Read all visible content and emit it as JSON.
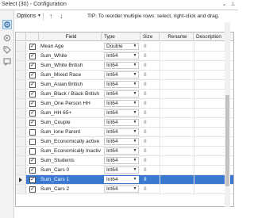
{
  "window": {
    "title": "Select (30) - Configuration"
  },
  "toolbar": {
    "options_label": "Options",
    "tip": "TIP: To reorder multiple rows: select, right-click and drag."
  },
  "grid": {
    "columns": [
      "Field",
      "Type",
      "Size",
      "Rename",
      "Description"
    ],
    "rows": [
      {
        "checked": true,
        "field": "Mean Age",
        "type": "Double",
        "size": "8",
        "selected": false
      },
      {
        "checked": true,
        "field": "Sum_White",
        "type": "Int64",
        "size": "8",
        "selected": false
      },
      {
        "checked": true,
        "field": "Sum_White British",
        "type": "Int64",
        "size": "8",
        "selected": false
      },
      {
        "checked": true,
        "field": "Sum_Mixed Race",
        "type": "Int64",
        "size": "8",
        "selected": false
      },
      {
        "checked": true,
        "field": "Sum_Asian British",
        "type": "Int64",
        "size": "8",
        "selected": false
      },
      {
        "checked": true,
        "field": "Sum_Black / Black British",
        "type": "Int64",
        "size": "8",
        "selected": false
      },
      {
        "checked": true,
        "field": "Sum_One Person HH",
        "type": "Int64",
        "size": "8",
        "selected": false
      },
      {
        "checked": true,
        "field": "Sum_HH 65+",
        "type": "Int64",
        "size": "8",
        "selected": false
      },
      {
        "checked": true,
        "field": "Sum_Couple",
        "type": "Int64",
        "size": "8",
        "selected": false
      },
      {
        "checked": false,
        "field": "Sum_lone Parent",
        "type": "Int64",
        "size": "8",
        "selected": false
      },
      {
        "checked": false,
        "field": "Sum_Economically active",
        "type": "Int64",
        "size": "8",
        "selected": false
      },
      {
        "checked": false,
        "field": "Sum_Economically Inactive",
        "type": "Int64",
        "size": "8",
        "selected": false
      },
      {
        "checked": true,
        "field": "Sum_Students",
        "type": "Int64",
        "size": "8",
        "selected": false
      },
      {
        "checked": true,
        "field": "Sum_Cars 0",
        "type": "Int64",
        "size": "8",
        "selected": false
      },
      {
        "checked": true,
        "field": "Sum_Cars 1",
        "type": "Int64",
        "size": "8",
        "selected": true
      },
      {
        "checked": true,
        "field": "Sum_Cars 2",
        "type": "Int64",
        "size": "8",
        "selected": false
      }
    ]
  },
  "icons": {
    "minimize": "minimize-icon",
    "pin": "pin-icon",
    "side_config": "gear-icon",
    "side_connections": "connection-icon",
    "side_tag": "tag-icon",
    "side_annotation": "annotation-icon",
    "move_up": "arrow-up-icon",
    "move_down": "arrow-down-icon"
  },
  "colors": {
    "accent": "#3b79d1",
    "header_bg": "#f4f4f4",
    "active_icon_bg": "#cfe4f7"
  }
}
